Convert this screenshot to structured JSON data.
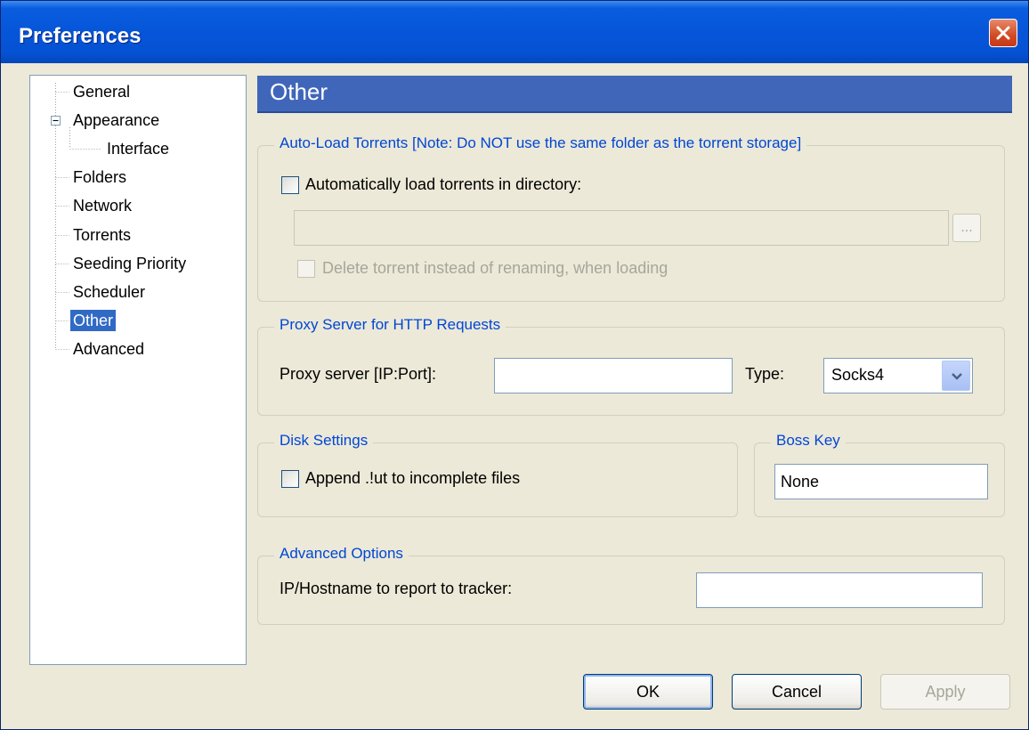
{
  "window": {
    "title": "Preferences"
  },
  "tree": {
    "items": [
      {
        "label": "General"
      },
      {
        "label": "Appearance",
        "expander": "−"
      },
      {
        "label": "Interface"
      },
      {
        "label": "Folders"
      },
      {
        "label": "Network"
      },
      {
        "label": "Torrents"
      },
      {
        "label": "Seeding Priority"
      },
      {
        "label": "Scheduler"
      },
      {
        "label": "Other",
        "selected": true
      },
      {
        "label": "Advanced"
      }
    ]
  },
  "panel": {
    "title": "Other"
  },
  "autoload": {
    "group_title": "Auto-Load Torrents [Note: Do NOT use the same folder as the torrent storage]",
    "checkbox_label": "Automatically load torrents in directory:",
    "directory_value": "",
    "browse_label": "...",
    "delete_label": "Delete torrent instead of renaming, when loading"
  },
  "proxy": {
    "group_title": "Proxy Server for HTTP Requests",
    "server_label": "Proxy server [IP:Port]:",
    "server_value": "",
    "type_label": "Type:",
    "type_value": "Socks4"
  },
  "disk": {
    "group_title": "Disk Settings",
    "append_label": "Append .!ut to incomplete files"
  },
  "bosskey": {
    "group_title": "Boss Key",
    "value": "None"
  },
  "advanced": {
    "group_title": "Advanced Options",
    "ip_label": "IP/Hostname to report to tracker:",
    "ip_value": ""
  },
  "buttons": {
    "ok": "OK",
    "cancel": "Cancel",
    "apply": "Apply"
  },
  "colors": {
    "title_bar": "#0655d9",
    "header_bar": "#3f66b9",
    "group_title": "#0046d5",
    "selection": "#316ac5"
  }
}
